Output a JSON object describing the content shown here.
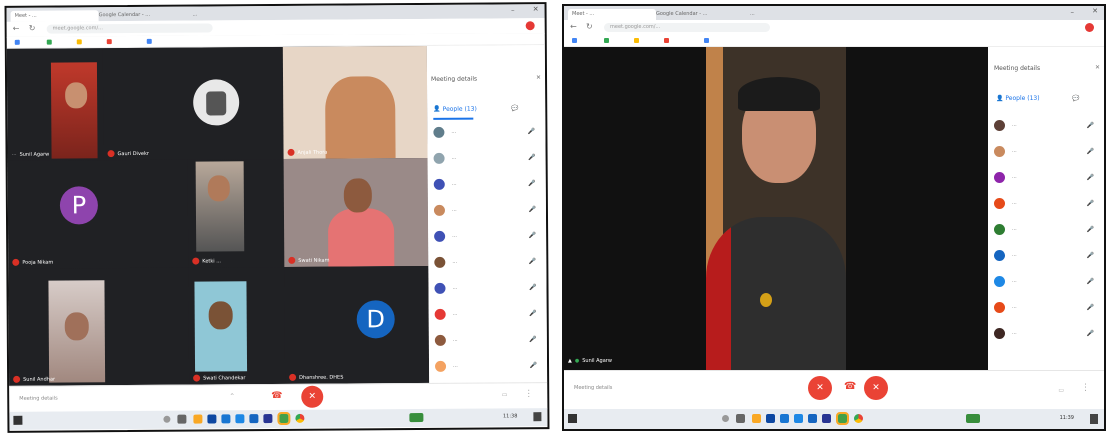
{
  "left": {
    "tabs": [
      "Meet - ...",
      "Google Calendar - ...",
      "..."
    ],
    "url": "meet.google.com/...",
    "tiles": [
      {
        "name": "Sunil Agarw"
      },
      {
        "name": "Gauri Divekr"
      },
      {
        "name": "Anjali Thora"
      },
      {
        "name": "Pooja Nikam",
        "letter": "P"
      },
      {
        "name": "Ketki ...",
        "letter": ""
      },
      {
        "name": "Swati Nikam"
      },
      {
        "name": "Sunil Andhar"
      },
      {
        "name": "Swati Chandekar"
      },
      {
        "name": "Dhanshree. DHES",
        "letter": "D"
      }
    ],
    "panel": {
      "title": "Meeting details",
      "tab_people": "People (13)",
      "tab_chat": "Chat",
      "count": "13"
    },
    "people": [
      "...",
      "...",
      "...",
      "...",
      "...",
      "...",
      "...",
      "...",
      "...",
      "...",
      "..."
    ],
    "meeting_info": "Meeting details",
    "clock": "11:38"
  },
  "right": {
    "tabs": [
      "Meet - ...",
      "Google Calendar - ...",
      "..."
    ],
    "url": "meet.google.com/...",
    "speaker": "Sunil Agarw",
    "panel": {
      "title": "Meeting details",
      "tab_people": "People (13)",
      "tab_chat": "Chat"
    },
    "people": [
      "...",
      "...",
      "...",
      "...",
      "...",
      "...",
      "...",
      "...",
      "..."
    ],
    "meeting_info": "Meeting details",
    "clock": "11:39"
  },
  "colors": {
    "accent": "#1a73e8",
    "hangup": "#ea4335",
    "mic_off": "#d93025",
    "avatar_p": "#8e44ad",
    "avatar_d": "#1565c0"
  }
}
